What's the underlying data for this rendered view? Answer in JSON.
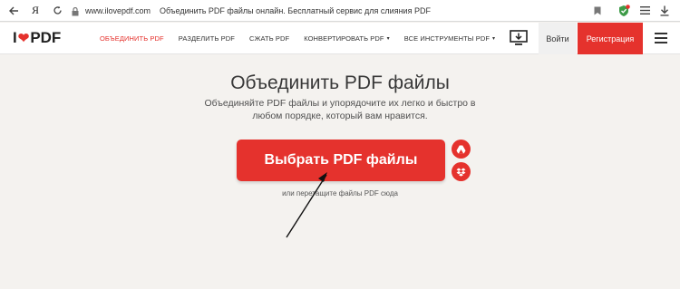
{
  "browser": {
    "back_icon": "arrow-left-icon",
    "yandex_label": "Я",
    "reload_icon": "reload-icon",
    "lock_icon": "lock-icon",
    "url": "www.ilovepdf.com",
    "tab_title": "Объединить PDF файлы онлайн. Бесплатный сервис для слияния PDF",
    "bookmark_icon": "bookmark-icon",
    "extension_icon": "shield-extension-icon",
    "menu_icon": "hamburger-menu-icon",
    "download_icon": "download-icon"
  },
  "site_header": {
    "logo": {
      "left": "I",
      "heart": "❤",
      "right": "PDF"
    },
    "nav": [
      {
        "label": "ОБЪЕДИНИТЬ PDF",
        "active": true,
        "has_caret": false
      },
      {
        "label": "РАЗДЕЛИТЬ PDF",
        "active": false,
        "has_caret": false
      },
      {
        "label": "СЖАТЬ PDF",
        "active": false,
        "has_caret": false
      },
      {
        "label": "КОНВЕРТИРОВАТЬ PDF",
        "active": false,
        "has_caret": true
      },
      {
        "label": "ВСЕ ИНСТРУМЕНТЫ PDF",
        "active": false,
        "has_caret": true
      }
    ],
    "caret": "▾",
    "desktop_icon": "desktop-download-icon",
    "login_label": "Войти",
    "register_label": "Регистрация",
    "hamburger_icon": "hamburger-icon"
  },
  "main": {
    "title": "Объединить PDF файлы",
    "subtitle": "Объединяйте PDF файлы и упорядочите их легко и быстро в любом порядке, который вам нравится.",
    "select_button": "Выбрать PDF файлы",
    "drive_icon": "google-drive-icon",
    "dropbox_icon": "dropbox-icon",
    "drop_hint": "или перетащите файлы PDF сюда"
  },
  "colors": {
    "accent": "#e5322d",
    "background": "#f4f2ef"
  }
}
